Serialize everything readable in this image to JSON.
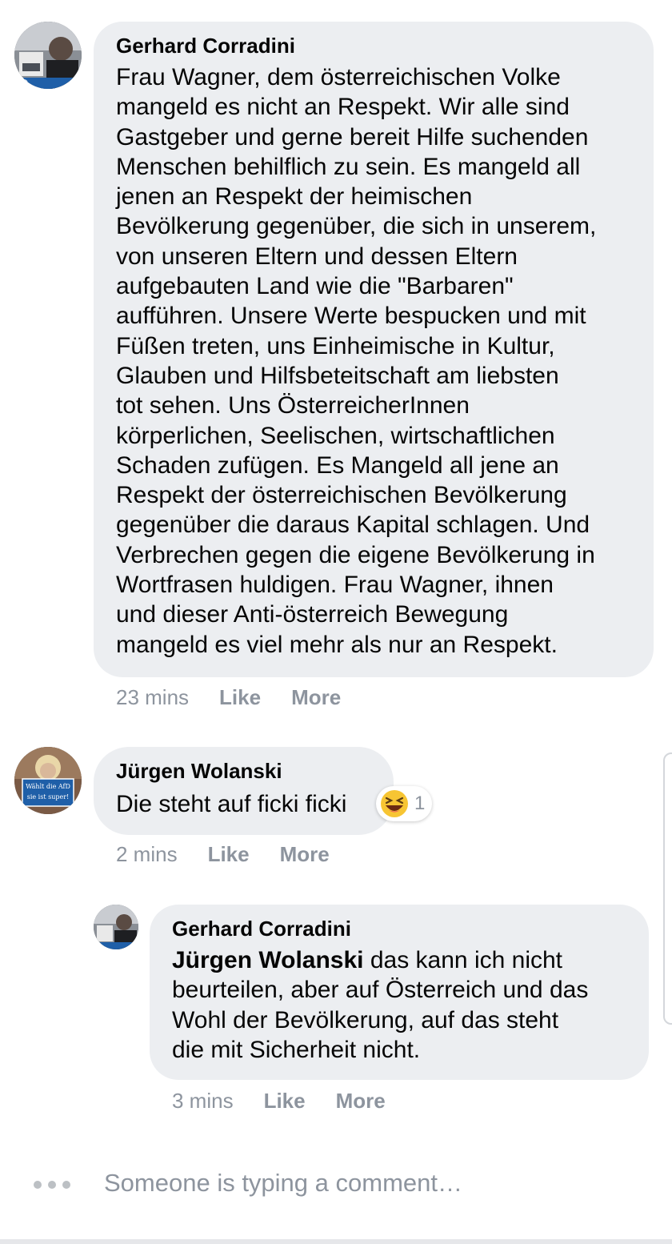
{
  "comments": [
    {
      "author": "Gerhard Corradini",
      "text": "Frau Wagner, dem österreichischen Volke\nmangeld es nicht an Respekt. Wir alle sind\nGastgeber und gerne bereit Hilfe suchenden\nMenschen behilflich zu sein. Es mangeld all\njenen an Respekt der heimischen\nBevölkerung gegenüber, die sich in unserem,\nvon unseren Eltern und dessen Eltern\naufgebauten Land wie die \"Barbaren\"\naufführen. Unsere Werte bespucken und mit\nFüßen treten, uns Einheimische in Kultur,\nGlauben und Hilfsbeteitschaft am liebsten\ntot sehen. Uns ÖsterreicherInnen\nkörperlichen, Seelischen, wirtschaftlichen\nSchaden zufügen. Es Mangeld all jene an\nRespekt der österreichischen Bevölkerung\ngegenüber die daraus Kapital schlagen. Und\nVerbrechen gegen die eigene Bevölkerung in\nWortfrasen huldigen. Frau Wagner, ihnen\nund dieser Anti-österreich Bewegung\nmangeld es viel mehr als nur an Respekt.",
      "time": "23 mins",
      "like": "Like",
      "more": "More"
    },
    {
      "author": "Jürgen Wolanski",
      "text": "Die steht auf ficki ficki",
      "time": "2 mins",
      "like": "Like",
      "more": "More",
      "reaction": {
        "icon": "laughing-emoji",
        "count": "1"
      },
      "avatar_sign": "Wählt die AfD, sie ist super!"
    },
    {
      "author": "Gerhard Corradini",
      "mention": "Jürgen Wolanski",
      "text": " das kann ich nicht\nbeurteilen, aber auf Österreich und das\nWohl der Bevölkerung, auf das steht\ndie mit Sicherheit nicht.",
      "time": "3 mins",
      "like": "Like",
      "more": "More"
    }
  ],
  "typing_indicator": "Someone is typing a comment…",
  "colors": {
    "bubble": "#eceef1",
    "meta_text": "#8d949e",
    "text": "#050505"
  }
}
